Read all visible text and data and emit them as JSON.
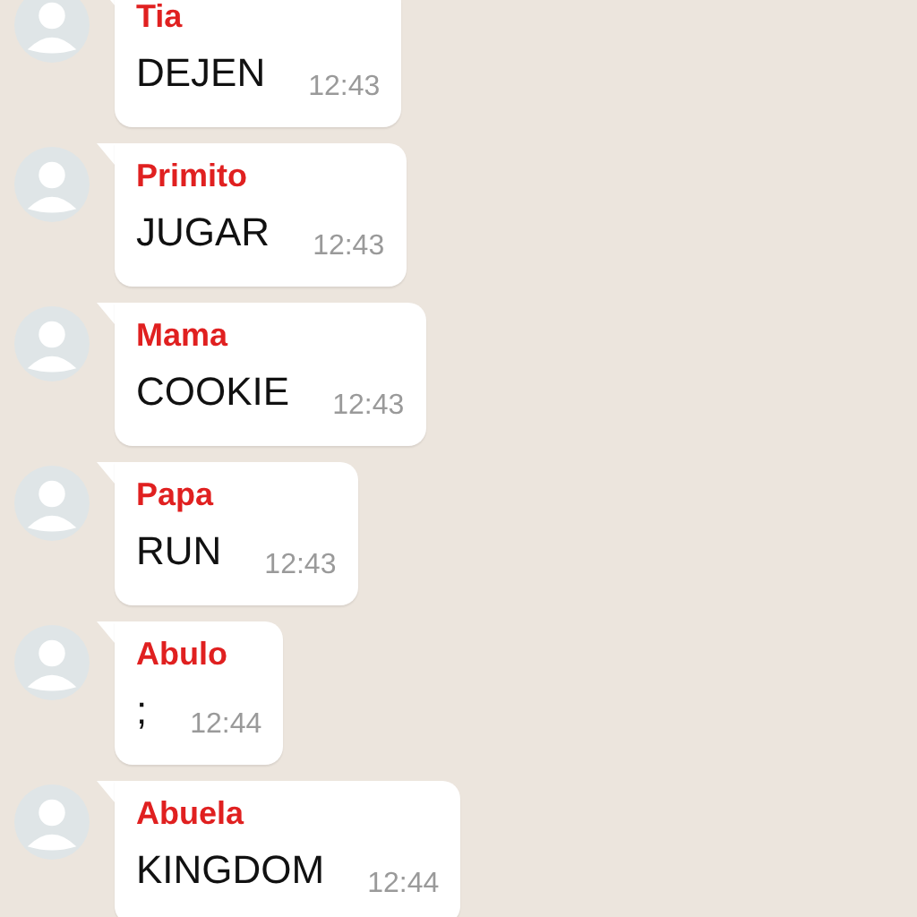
{
  "messages": [
    {
      "sender": "Tia",
      "text": "DEJEN",
      "time": "12:43"
    },
    {
      "sender": "Primito",
      "text": "JUGAR",
      "time": "12:43"
    },
    {
      "sender": "Mama",
      "text": "COOKIE",
      "time": "12:43"
    },
    {
      "sender": "Papa",
      "text": "RUN",
      "time": "12:43"
    },
    {
      "sender": "Abulo",
      "text": ";",
      "time": "12:44"
    },
    {
      "sender": "Abuela",
      "text": "KINGDOM",
      "time": "12:44"
    }
  ]
}
